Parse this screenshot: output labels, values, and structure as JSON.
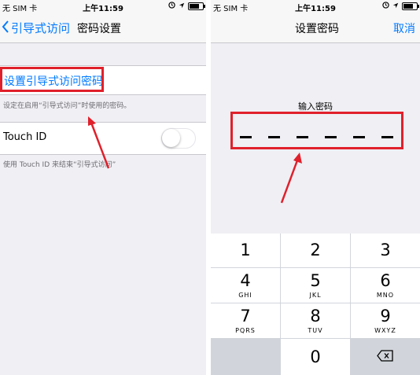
{
  "left": {
    "status": {
      "carrier": "无 SIM 卡",
      "time": "上午11:59"
    },
    "nav": {
      "back_label": "引导式访问",
      "title": "密码设置"
    },
    "set_passcode_label": "设置引导式访问密码",
    "set_passcode_footer": "设定在启用“引导式访问”时使用的密码。",
    "touch_id_label": "Touch ID",
    "touch_id_on": false,
    "touch_id_footer": "使用 Touch ID 来结束“引导式访问”"
  },
  "right": {
    "status": {
      "carrier": "无 SIM 卡",
      "time": "上午11:59"
    },
    "nav": {
      "title": "设置密码",
      "cancel_label": "取消"
    },
    "prompt": "输入密码",
    "digits_entered": 0,
    "digit_slots": 6,
    "keys": [
      {
        "num": "1",
        "letters": ""
      },
      {
        "num": "2",
        "letters": ""
      },
      {
        "num": "3",
        "letters": ""
      },
      {
        "num": "4",
        "letters": "GHI"
      },
      {
        "num": "5",
        "letters": "JKL"
      },
      {
        "num": "6",
        "letters": "MNO"
      },
      {
        "num": "7",
        "letters": "PQRS"
      },
      {
        "num": "8",
        "letters": "TUV"
      },
      {
        "num": "9",
        "letters": "WXYZ"
      },
      {
        "num": "0",
        "letters": ""
      }
    ]
  },
  "colors": {
    "accent": "#007aff",
    "annotation": "#e0202b",
    "background": "#efeff4"
  },
  "icons": [
    "back-chevron-icon",
    "wifi-icon",
    "location-icon",
    "alarm-icon",
    "battery-icon",
    "delete-backspace-icon",
    "red-arrow-annotation"
  ]
}
